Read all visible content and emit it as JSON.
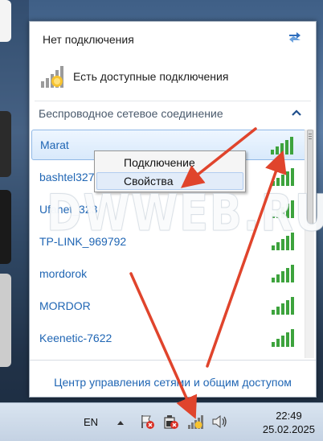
{
  "flyout": {
    "status_title": "Нет подключения",
    "available_text": "Есть доступные подключения",
    "section_title": "Беспроводное сетевое соединение",
    "networks": [
      {
        "name": "Marat",
        "selected": true
      },
      {
        "name": "bashtel327"
      },
      {
        "name": "Ufanet_323"
      },
      {
        "name": "TP-LINK_969792"
      },
      {
        "name": "mordorok"
      },
      {
        "name": "MORDOR"
      },
      {
        "name": "Keenetic-7622"
      }
    ],
    "footer_link": "Центр управления сетями и общим доступом"
  },
  "context_menu": {
    "items": [
      "Подключение",
      "Свойства"
    ]
  },
  "watermark": "DWWEB.RU",
  "taskbar": {
    "language": "EN",
    "time": "22:49",
    "date": "25.02.2025"
  },
  "colors": {
    "link": "#2066b4",
    "signal_green": "#3da33d",
    "arrow_red": "#e0442c"
  },
  "icons": [
    "refresh-icon",
    "network-available-icon",
    "collapse-chevron-icon",
    "wifi-signal-icon",
    "tray-expand-icon",
    "action-center-flag-icon",
    "power-battery-icon",
    "network-tray-icon",
    "volume-icon"
  ]
}
